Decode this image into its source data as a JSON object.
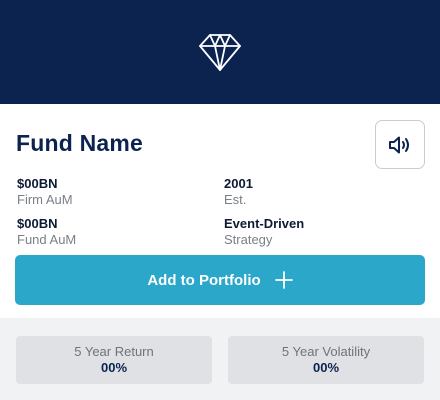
{
  "hero": {
    "icon": "diamond-icon",
    "background": "#0c2350"
  },
  "fund": {
    "name": "Fund Name",
    "sound_icon": "speaker-icon",
    "stats": [
      {
        "value": "$00BN",
        "label": "Firm AuM"
      },
      {
        "value": "2001",
        "label": "Est."
      },
      {
        "value": "$00BN",
        "label": "Fund AuM"
      },
      {
        "value": "Event-Driven",
        "label": "Strategy"
      }
    ]
  },
  "actions": {
    "add_label": "Add to Portfolio",
    "add_icon": "plus-icon",
    "accent": "#2aa7c9"
  },
  "metrics": [
    {
      "label": "5 Year Return",
      "value": "00%"
    },
    {
      "label": "5 Year Volatility",
      "value": "00%"
    }
  ]
}
